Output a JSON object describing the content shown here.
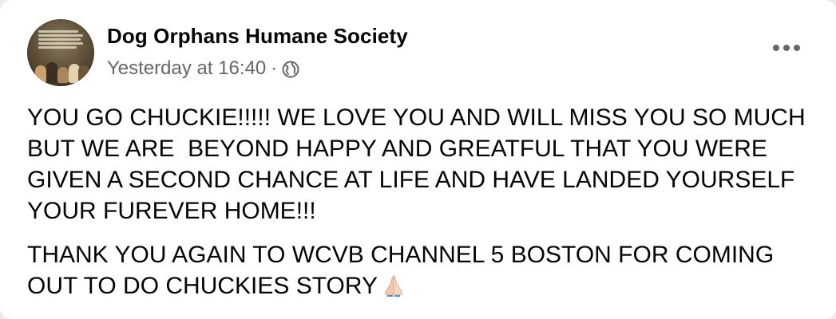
{
  "post": {
    "author": "Dog Orphans Humane Society",
    "timestamp": "Yesterday at 16:40",
    "separator": "·",
    "audience_icon": "globe-icon",
    "menu_icon": "more-options-icon",
    "paragraphs": [
      "YOU GO CHUCKIE!!!!! WE LOVE YOU AND WILL MISS YOU SO MUCH BUT WE ARE  BEYOND HAPPY AND GREATFUL THAT YOU WERE GIVEN A SECOND CHANCE AT LIFE AND HAVE LANDED YOURSELF YOUR FUREVER HOME!!!",
      "THANK YOU AGAIN TO WCVB CHANNEL 5 BOSTON FOR COMING OUT TO DO CHUCKIES STORY"
    ],
    "trailing_emoji": "folded-hands-emoji"
  },
  "colors": {
    "text_primary": "#050505",
    "text_secondary": "#65676b",
    "card_background": "#ffffff"
  }
}
